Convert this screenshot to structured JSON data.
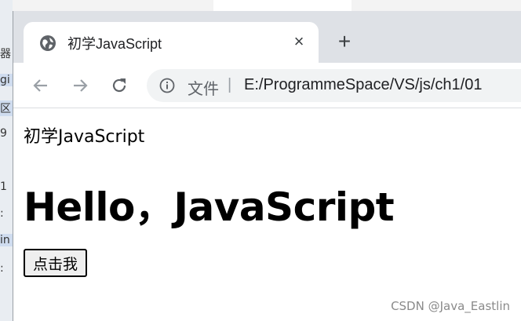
{
  "background_fragments": {
    "items": [
      "器",
      "gi",
      "区",
      "9",
      "1 ",
      ":",
      "in",
      ":"
    ]
  },
  "browser": {
    "tab": {
      "title": "初学JavaScript",
      "close_glyph": "×"
    },
    "new_tab_glyph": "+",
    "address_bar": {
      "file_label": "文件",
      "separator": "|",
      "url": "E:/ProgrammeSpace/VS/js/ch1/01"
    }
  },
  "page": {
    "text_line": "初学JavaScript",
    "heading": "Hello，JavaScript",
    "button_label": "点击我"
  },
  "watermark": "CSDN @Java_Eastlin",
  "colors": {
    "tabstrip": "#dee1e6",
    "omnibox": "#f1f3f4",
    "icon": "#5f6368"
  }
}
